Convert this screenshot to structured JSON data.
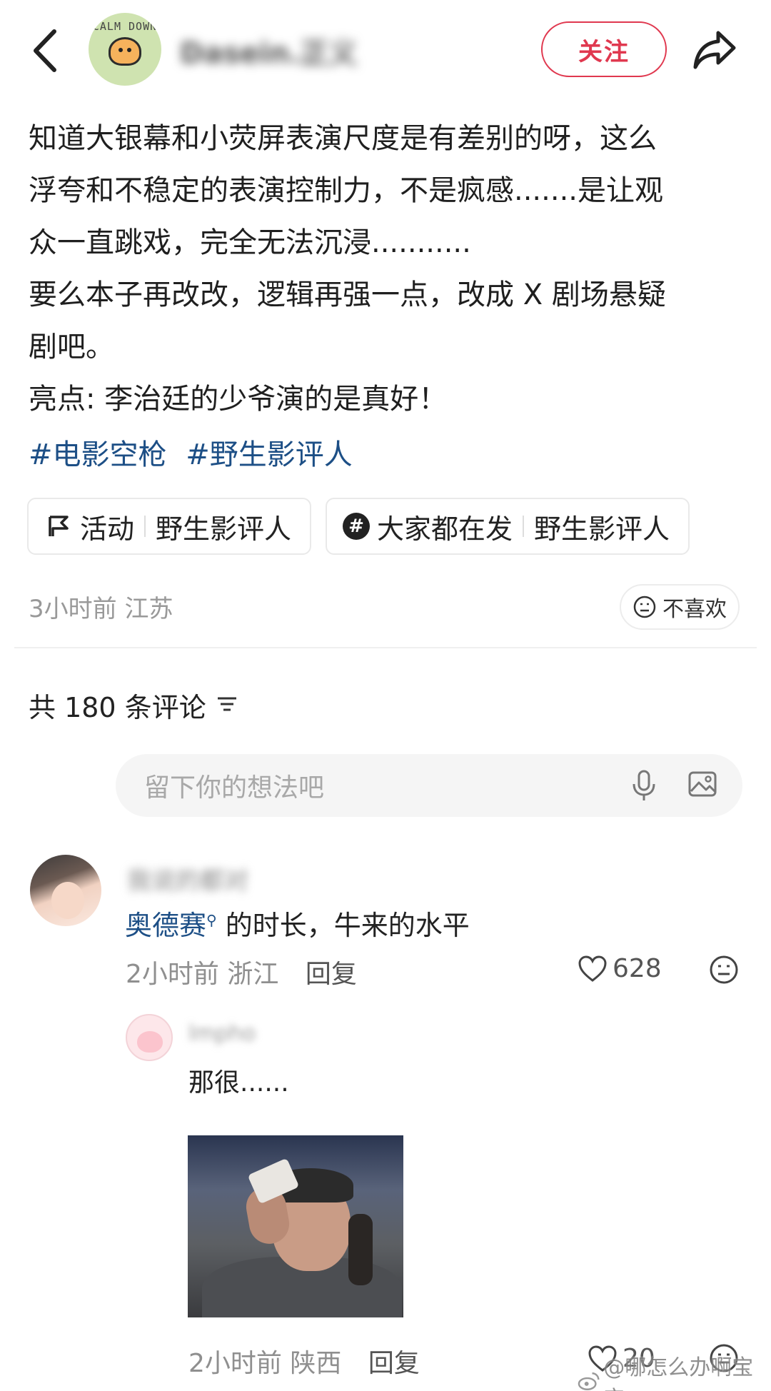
{
  "header": {
    "avatar_text": "CALM DOWN",
    "username": "Dasein.正义",
    "follow_label": "关注"
  },
  "post": {
    "lines": [
      "知道大银幕和小荧屏表演尺度是有差别的呀，这么",
      "浮夸和不稳定的表演控制力，不是疯感.......是让观",
      "众一直跳戏，完全无法沉浸...........",
      "要么本子再改改，逻辑再强一点，改成 X 剧场悬疑",
      "剧吧。",
      "亮点: 李治廷的少爷演的是真好！"
    ],
    "hashtags": [
      "#电影空枪",
      "#野生影评人"
    ],
    "chips": [
      {
        "label": "活动",
        "value": "野生影评人"
      },
      {
        "label": "大家都在发",
        "value": "野生影评人"
      }
    ],
    "meta": "3小时前 江苏",
    "dislike_label": "不喜欢"
  },
  "comments_section": {
    "count_label": "共 180 条评论",
    "input_placeholder": "留下你的想法吧"
  },
  "comment1": {
    "username": "我说的都对",
    "link_text": "奥德赛",
    "text": "的时长，牛来的水平",
    "meta": "2小时前 浙江",
    "reply_label": "回复",
    "likes": "628"
  },
  "reply1": {
    "username": "lmpho",
    "text": "那很......",
    "meta": "2小时前 陕西",
    "reply_label": "回复",
    "likes": "20"
  },
  "watermark": "@哪怎么办啊宝宝",
  "colors": {
    "accent": "#e0384f",
    "link": "#1d4f86",
    "muted": "#999999"
  }
}
